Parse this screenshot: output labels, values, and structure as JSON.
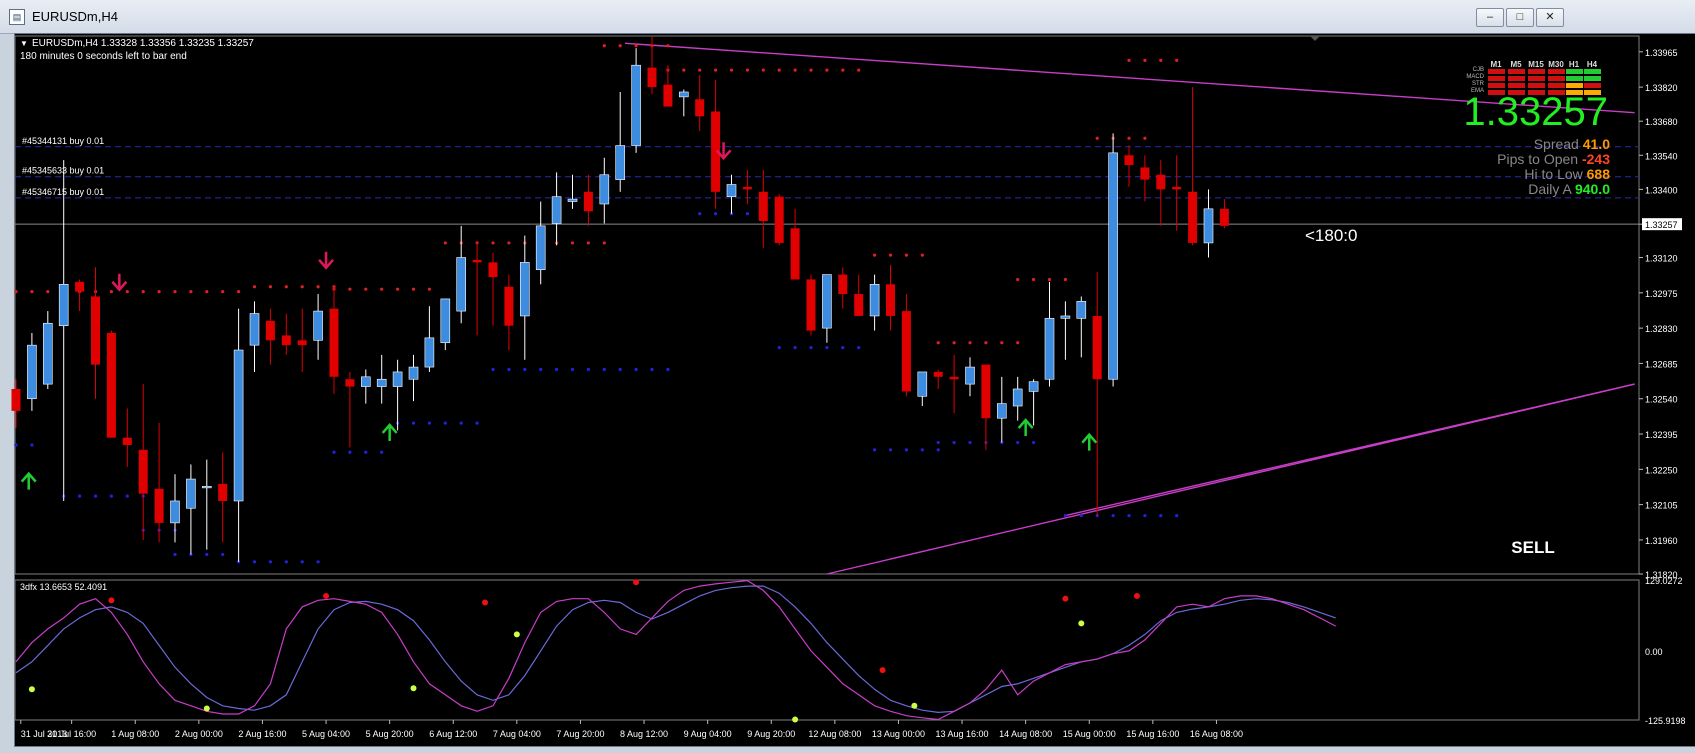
{
  "window": {
    "title": "EURUSDm,H4",
    "minimize_label": "–",
    "restore_label": "□",
    "close_label": "✕"
  },
  "chart_header": {
    "symbol_line": "EURUSDm,H4  1.33328 1.33356 1.33235 1.33257",
    "bar_timer": "180 minutes 0 seconds left to bar end"
  },
  "orders": [
    {
      "label": "#45344131 buy 0.01",
      "price": 1.33575
    },
    {
      "label": "#45345633 buy 0.01",
      "price": 1.33452
    },
    {
      "label": "#45346715 buy 0.01",
      "price": 1.33365
    }
  ],
  "info_panel": {
    "price": "1.33257",
    "spread_label": "Spread",
    "spread_value": "41.0",
    "pips_label": "Pips to Open",
    "pips_value": "-243",
    "hilo_label": "Hi to Low",
    "hilo_value": "688",
    "daily_label": "Daily A",
    "daily_value": "940.0",
    "timeframes": [
      "M1",
      "M5",
      "M15",
      "M30",
      "H1",
      "H4"
    ],
    "indicators": [
      "CJB",
      "MACD",
      "STR",
      "EMA"
    ]
  },
  "bar_countdown": "<180:0",
  "signal": "SELL",
  "current_price_tag": "1.33257",
  "indicator_pane": {
    "label": "3dfx 13.6653 52.4091"
  },
  "colors": {
    "bull": "#3d8ce0",
    "bear": "#e00000",
    "trendline": "#c83ec8",
    "background": "#000000"
  },
  "chart_data": {
    "type": "candlestick",
    "y_ticks": [
      "1.33965",
      "1.33820",
      "1.33680",
      "1.33540",
      "1.33400",
      "1.33257",
      "1.33120",
      "1.32975",
      "1.32830",
      "1.32685",
      "1.32540",
      "1.32395",
      "1.32250",
      "1.32105",
      "1.31960",
      "1.31820"
    ],
    "indicator_y_ticks": [
      "129.0272",
      "0.00",
      "-125.9198"
    ],
    "x_ticks": [
      "31 Jul 2013",
      "31 Jul 16:00",
      "1 Aug 08:00",
      "2 Aug 00:00",
      "2 Aug 16:00",
      "5 Aug 04:00",
      "5 Aug 20:00",
      "6 Aug 12:00",
      "7 Aug 04:00",
      "7 Aug 20:00",
      "8 Aug 12:00",
      "9 Aug 04:00",
      "9 Aug 20:00",
      "12 Aug 08:00",
      "13 Aug 00:00",
      "13 Aug 16:00",
      "14 Aug 08:00",
      "15 Aug 00:00",
      "15 Aug 16:00",
      "16 Aug 08:00"
    ],
    "ylim": [
      1.3182,
      1.3403
    ],
    "candles": [
      [
        1.3258,
        1.3262,
        1.3242,
        1.3249
      ],
      [
        1.3254,
        1.3281,
        1.3249,
        1.3276
      ],
      [
        1.326,
        1.329,
        1.3258,
        1.3285
      ],
      [
        1.3284,
        1.3352,
        1.3212,
        1.3301
      ],
      [
        1.3302,
        1.3303,
        1.329,
        1.3298
      ],
      [
        1.3296,
        1.3308,
        1.3254,
        1.3268
      ],
      [
        1.3281,
        1.3282,
        1.3238,
        1.3238
      ],
      [
        1.3238,
        1.325,
        1.3226,
        1.3235
      ],
      [
        1.3233,
        1.326,
        1.3196,
        1.3215
      ],
      [
        1.3217,
        1.3244,
        1.3195,
        1.3203
      ],
      [
        1.3203,
        1.3223,
        1.3195,
        1.3212
      ],
      [
        1.3209,
        1.3227,
        1.319,
        1.3221
      ],
      [
        1.3218,
        1.3229,
        1.3192,
        1.3218
      ],
      [
        1.3219,
        1.3232,
        1.3195,
        1.3212
      ],
      [
        1.3212,
        1.3291,
        1.3187,
        1.3274
      ],
      [
        1.3276,
        1.3294,
        1.3265,
        1.3289
      ],
      [
        1.3286,
        1.3291,
        1.3268,
        1.3278
      ],
      [
        1.328,
        1.3289,
        1.3272,
        1.3276
      ],
      [
        1.3278,
        1.3291,
        1.3265,
        1.3276
      ],
      [
        1.3278,
        1.3297,
        1.327,
        1.329
      ],
      [
        1.3291,
        1.33,
        1.3256,
        1.3263
      ],
      [
        1.3262,
        1.3265,
        1.3234,
        1.3259
      ],
      [
        1.3259,
        1.3266,
        1.3252,
        1.3263
      ],
      [
        1.3259,
        1.3272,
        1.3252,
        1.3262
      ],
      [
        1.3259,
        1.327,
        1.3241,
        1.3265
      ],
      [
        1.3262,
        1.3272,
        1.3253,
        1.3267
      ],
      [
        1.3267,
        1.3292,
        1.3265,
        1.3279
      ],
      [
        1.3277,
        1.329,
        1.3274,
        1.3295
      ],
      [
        1.329,
        1.3325,
        1.3285,
        1.3312
      ],
      [
        1.3311,
        1.3318,
        1.328,
        1.331
      ],
      [
        1.331,
        1.3314,
        1.3284,
        1.3304
      ],
      [
        1.33,
        1.3305,
        1.3274,
        1.3284
      ],
      [
        1.3288,
        1.3321,
        1.327,
        1.331
      ],
      [
        1.3307,
        1.3335,
        1.3301,
        1.3325
      ],
      [
        1.3326,
        1.3347,
        1.3317,
        1.3337
      ],
      [
        1.3335,
        1.3346,
        1.3332,
        1.3336
      ],
      [
        1.3339,
        1.3346,
        1.3325,
        1.3331
      ],
      [
        1.3334,
        1.3353,
        1.3326,
        1.3346
      ],
      [
        1.3344,
        1.338,
        1.3339,
        1.3358
      ],
      [
        1.3358,
        1.3398,
        1.3355,
        1.3391
      ],
      [
        1.339,
        1.3403,
        1.3379,
        1.3382
      ],
      [
        1.3383,
        1.3391,
        1.3375,
        1.3374
      ],
      [
        1.3378,
        1.3381,
        1.337,
        1.338
      ],
      [
        1.3377,
        1.3387,
        1.3364,
        1.337
      ],
      [
        1.3372,
        1.3385,
        1.3332,
        1.3339
      ],
      [
        1.3337,
        1.3346,
        1.333,
        1.3342
      ],
      [
        1.3341,
        1.3348,
        1.3334,
        1.334
      ],
      [
        1.3339,
        1.3348,
        1.3316,
        1.3327
      ],
      [
        1.3337,
        1.3338,
        1.3317,
        1.3318
      ],
      [
        1.3324,
        1.3332,
        1.3304,
        1.3303
      ],
      [
        1.3303,
        1.3305,
        1.328,
        1.3282
      ],
      [
        1.3283,
        1.3305,
        1.3277,
        1.3305
      ],
      [
        1.3305,
        1.3308,
        1.3291,
        1.3297
      ],
      [
        1.3297,
        1.3305,
        1.3289,
        1.3288
      ],
      [
        1.3288,
        1.3305,
        1.3282,
        1.3301
      ],
      [
        1.3301,
        1.3309,
        1.3282,
        1.3288
      ],
      [
        1.329,
        1.3297,
        1.3255,
        1.3257
      ],
      [
        1.3255,
        1.3264,
        1.3251,
        1.3265
      ],
      [
        1.3265,
        1.3266,
        1.3258,
        1.3263
      ],
      [
        1.3263,
        1.3272,
        1.3248,
        1.3262
      ],
      [
        1.326,
        1.3271,
        1.3255,
        1.3267
      ],
      [
        1.3268,
        1.3268,
        1.3233,
        1.3246
      ],
      [
        1.3246,
        1.3263,
        1.3236,
        1.3252
      ],
      [
        1.3251,
        1.3263,
        1.3245,
        1.3258
      ],
      [
        1.3257,
        1.3262,
        1.3243,
        1.3261
      ],
      [
        1.3262,
        1.3302,
        1.3259,
        1.3287
      ],
      [
        1.3287,
        1.3294,
        1.327,
        1.3288
      ],
      [
        1.3287,
        1.3296,
        1.3271,
        1.3294
      ],
      [
        1.3288,
        1.3306,
        1.3206,
        1.3262
      ],
      [
        1.3262,
        1.3363,
        1.3259,
        1.3355
      ],
      [
        1.3354,
        1.3358,
        1.3341,
        1.335
      ],
      [
        1.3349,
        1.3354,
        1.3335,
        1.3344
      ],
      [
        1.3346,
        1.3352,
        1.3325,
        1.334
      ],
      [
        1.3341,
        1.3354,
        1.3323,
        1.334
      ],
      [
        1.3339,
        1.3382,
        1.3317,
        1.3318
      ],
      [
        1.3318,
        1.334,
        1.3312,
        1.3332
      ],
      [
        1.3332,
        1.3336,
        1.3324,
        1.3325
      ]
    ],
    "osc_main": [
      -20,
      15,
      40,
      60,
      85,
      95,
      70,
      30,
      -20,
      -60,
      -90,
      -100,
      -110,
      -115,
      -115,
      -100,
      -60,
      40,
      80,
      92,
      95,
      90,
      85,
      70,
      30,
      -20,
      -60,
      -80,
      -100,
      -110,
      -100,
      -50,
      15,
      70,
      90,
      95,
      95,
      70,
      40,
      30,
      60,
      90,
      110,
      118,
      122,
      125,
      128,
      110,
      80,
      40,
      0,
      -30,
      -60,
      -80,
      -100,
      -110,
      -118,
      -122,
      -125,
      -110,
      -95,
      -70,
      -35,
      -80,
      -55,
      -40,
      -25,
      -20,
      -15,
      -5,
      0,
      20,
      50,
      80,
      85,
      80,
      95,
      100,
      100,
      95,
      85,
      75,
      60,
      45
    ],
    "osc_signal": [
      -40,
      -20,
      10,
      40,
      60,
      75,
      80,
      70,
      50,
      10,
      -30,
      -60,
      -85,
      -100,
      -105,
      -108,
      -100,
      -80,
      -20,
      40,
      75,
      88,
      90,
      85,
      75,
      55,
      20,
      -20,
      -55,
      -80,
      -90,
      -80,
      -45,
      0,
      45,
      75,
      88,
      92,
      88,
      70,
      58,
      70,
      85,
      100,
      110,
      115,
      118,
      118,
      105,
      80,
      50,
      15,
      -15,
      -45,
      -70,
      -90,
      -100,
      -108,
      -112,
      -110,
      -95,
      -80,
      -65,
      -60,
      -50,
      -40,
      -30,
      -20,
      -15,
      -5,
      10,
      30,
      55,
      70,
      76,
      80,
      85,
      92,
      95,
      93,
      88,
      80,
      70,
      60
    ]
  }
}
